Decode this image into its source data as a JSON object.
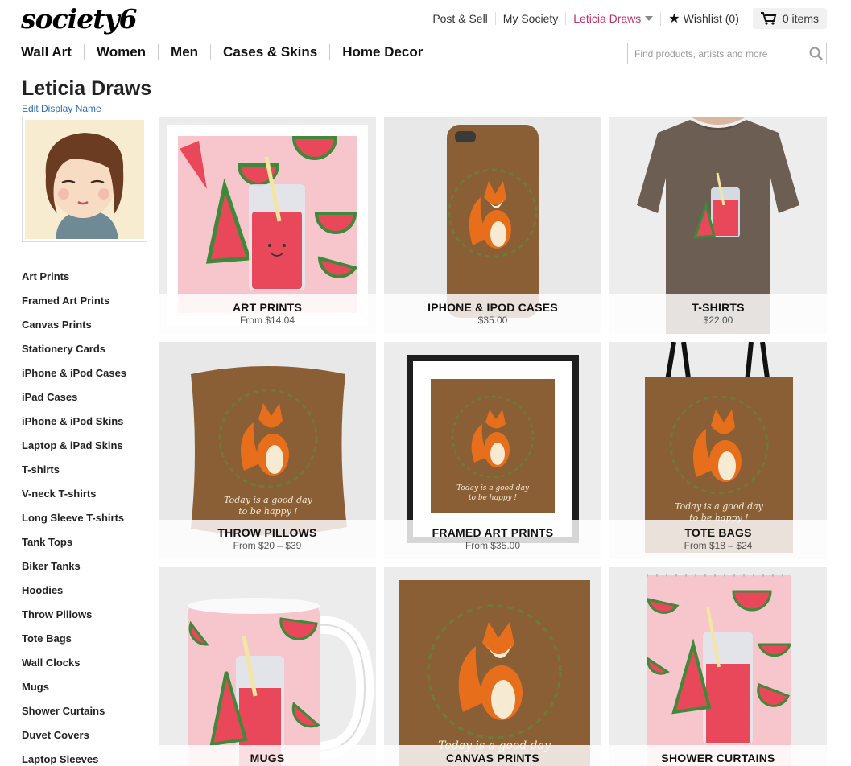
{
  "header": {
    "logo": "society6",
    "links": {
      "post_sell": "Post & Sell",
      "my_society": "My Society",
      "user": "Leticia Draws",
      "wishlist": "Wishlist (0)",
      "cart": "0 items"
    },
    "nav": [
      "Wall Art",
      "Women",
      "Men",
      "Cases & Skins",
      "Home Decor"
    ],
    "search_placeholder": "Find products, artists and more"
  },
  "profile": {
    "name": "Leticia Draws",
    "edit_label": "Edit Display Name"
  },
  "sidebar": [
    "Art Prints",
    "Framed Art Prints",
    "Canvas Prints",
    "Stationery Cards",
    "iPhone & iPod Cases",
    "iPad Cases",
    "iPhone & iPod Skins",
    "Laptop & iPad Skins",
    "T-shirts",
    "V-neck T-shirts",
    "Long Sleeve T-shirts",
    "Tank Tops",
    "Biker Tanks",
    "Hoodies",
    "Throw Pillows",
    "Tote Bags",
    "Wall Clocks",
    "Mugs",
    "Shower Curtains",
    "Duvet Covers",
    "Laptop Sleeves"
  ],
  "products": [
    {
      "title": "ART PRINTS",
      "price": "From $14.04",
      "art": "watermelon-print"
    },
    {
      "title": "IPHONE & IPOD CASES",
      "price": "$35.00",
      "art": "fox-phone-case"
    },
    {
      "title": "T-SHIRTS",
      "price": "$22.00",
      "art": "tshirt"
    },
    {
      "title": "THROW PILLOWS",
      "price": "From $20 – $39",
      "art": "fox-pillow"
    },
    {
      "title": "FRAMED ART PRINTS",
      "price": "From $35.00",
      "art": "fox-framed"
    },
    {
      "title": "TOTE BAGS",
      "price": "From $18 – $24",
      "art": "fox-tote"
    },
    {
      "title": "MUGS",
      "price": "",
      "art": "watermelon-mug"
    },
    {
      "title": "CANVAS PRINTS",
      "price": "",
      "art": "fox-canvas"
    },
    {
      "title": "SHOWER CURTAINS",
      "price": "",
      "art": "watermelon-curtain"
    }
  ],
  "artwork_text": {
    "fox_quote_line1": "Today is a good day",
    "fox_quote_line2": "to be happy !"
  },
  "colors": {
    "accent": "#c0306b",
    "link": "#2e6db4",
    "fox_bg": "#8a5f36",
    "pink": "#f6c6cc",
    "melon": "#e8485a"
  }
}
